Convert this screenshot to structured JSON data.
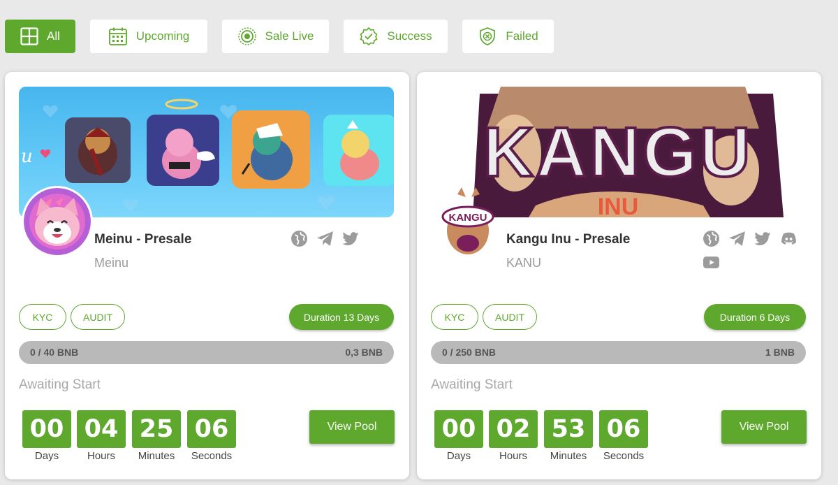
{
  "filters": [
    {
      "label": "All",
      "icon": "grid-icon",
      "active": true
    },
    {
      "label": "Upcoming",
      "icon": "calendar-icon",
      "active": false
    },
    {
      "label": "Sale Live",
      "icon": "live-icon",
      "active": false
    },
    {
      "label": "Success",
      "icon": "badge-check-icon",
      "active": false
    },
    {
      "label": "Failed",
      "icon": "shield-x-icon",
      "active": false
    }
  ],
  "colors": {
    "accent": "#5ea82d",
    "progress_track": "#b9b9b9",
    "muted_text": "#a8a8a8"
  },
  "cards": [
    {
      "title": "Meinu - Presale",
      "symbol": "Meinu",
      "banner_text": "u",
      "socials": [
        "globe-icon",
        "telegram-icon",
        "twitter-icon"
      ],
      "badges": [
        "KYC",
        "AUDIT"
      ],
      "duration": "Duration 13 Days",
      "progress_left": "0 / 40 BNB",
      "progress_right": "0,3 BNB",
      "progress_fraction": 0,
      "status": "Awaiting Start",
      "timer": [
        {
          "value": "00",
          "label": "Days"
        },
        {
          "value": "04",
          "label": "Hours"
        },
        {
          "value": "25",
          "label": "Minutes"
        },
        {
          "value": "06",
          "label": "Seconds"
        }
      ],
      "button": "View Pool"
    },
    {
      "title": "Kangu Inu - Presale",
      "symbol": "KANU",
      "banner_text": "KANGU",
      "banner_subtext": "INU",
      "logo_text": "KANGU",
      "socials": [
        "globe-icon",
        "telegram-icon",
        "twitter-icon",
        "discord-icon",
        "youtube-icon"
      ],
      "badges": [
        "KYC",
        "AUDIT"
      ],
      "duration": "Duration 6 Days",
      "progress_left": "0 / 250 BNB",
      "progress_right": "1 BNB",
      "progress_fraction": 0,
      "status": "Awaiting Start",
      "timer": [
        {
          "value": "00",
          "label": "Days"
        },
        {
          "value": "02",
          "label": "Hours"
        },
        {
          "value": "53",
          "label": "Minutes"
        },
        {
          "value": "06",
          "label": "Seconds"
        }
      ],
      "button": "View Pool"
    }
  ]
}
